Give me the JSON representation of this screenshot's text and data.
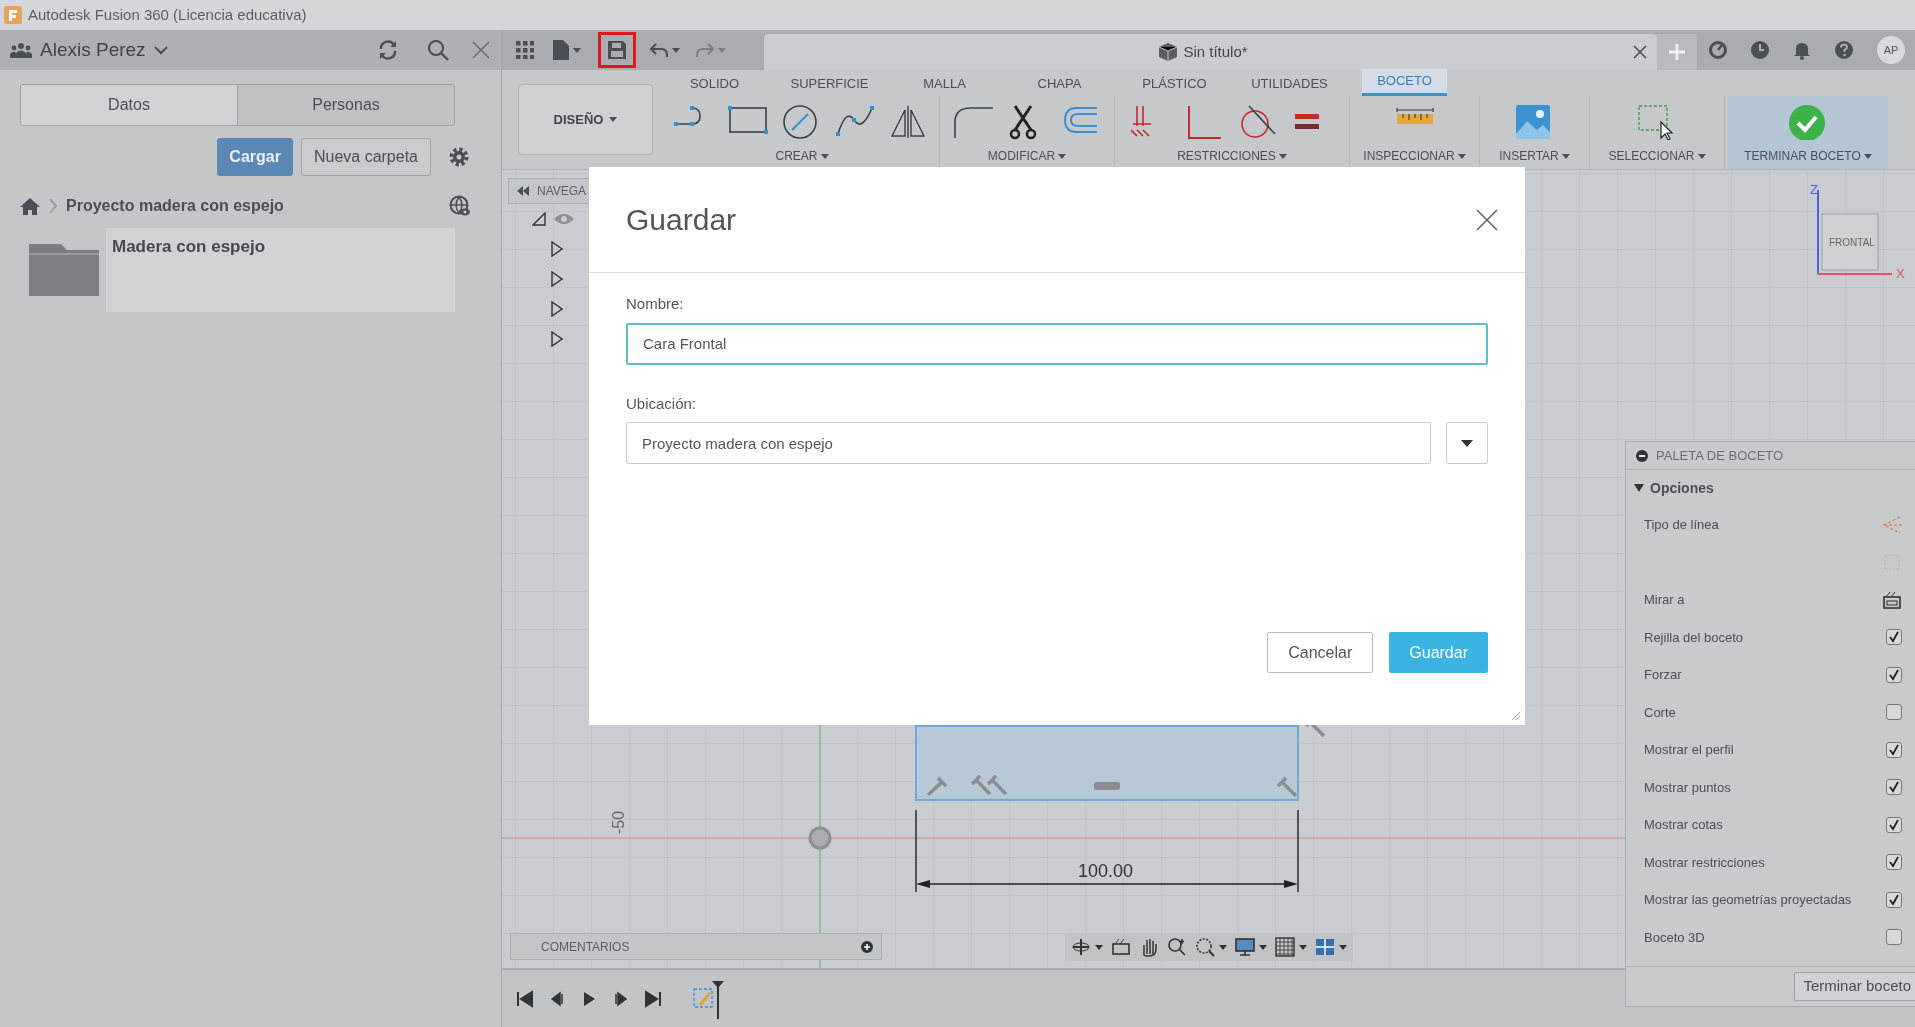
{
  "window": {
    "title": "Autodesk Fusion 360 (Licencia educativa)"
  },
  "data_panel": {
    "user": "Alexis Perez",
    "tabs": [
      {
        "label": "Datos",
        "selected": true
      },
      {
        "label": "Personas",
        "selected": false
      }
    ],
    "buttons": [
      {
        "label": "Cargar",
        "kind": "primary"
      },
      {
        "label": "Nueva carpeta",
        "kind": "secondary"
      }
    ],
    "breadcrumb": "Proyecto madera con espejo",
    "folders": [
      {
        "name": "Madera con espejo"
      }
    ]
  },
  "top_bar": {
    "save_highlighted": true,
    "document_title": "Sin título*",
    "user_initials": "AP"
  },
  "ribbon": {
    "workspace": "DISEÑO",
    "tabs": [
      {
        "label": "SOLIDO",
        "selected": false
      },
      {
        "label": "SUPERFICIE",
        "selected": false
      },
      {
        "label": "MALLA",
        "selected": false
      },
      {
        "label": "CHAPA",
        "selected": false
      },
      {
        "label": "PLÁSTICO",
        "selected": false
      },
      {
        "label": "UTILIDADES",
        "selected": false
      },
      {
        "label": "BOCETO",
        "selected": true
      }
    ],
    "groups": [
      {
        "label": "CREAR"
      },
      {
        "label": "MODIFICAR"
      },
      {
        "label": "RESTRICCIONES"
      },
      {
        "label": "INSPECCIONAR"
      },
      {
        "label": "INSERTAR"
      },
      {
        "label": "SELECCIONAR"
      },
      {
        "label": "TERMINAR BOCETO"
      }
    ]
  },
  "browser": {
    "title": "NAVEGA",
    "nodes": [
      {
        "expanded": true
      },
      {
        "expanded": false
      },
      {
        "expanded": false
      },
      {
        "expanded": false
      },
      {
        "expanded": false
      }
    ]
  },
  "view_cube": {
    "face": "FRONTAL",
    "axes": [
      "Z",
      "X"
    ]
  },
  "sketch": {
    "dimension": "100.00",
    "grid_label": "-50"
  },
  "comments": {
    "title": "COMENTARIOS"
  },
  "dialog": {
    "title": "Guardar",
    "fields": [
      {
        "label": "Nombre:",
        "value": "Cara Frontal",
        "focused": true,
        "kind": "text"
      },
      {
        "label": "Ubicación:",
        "value": "Proyecto madera con espejo",
        "focused": false,
        "kind": "select"
      }
    ],
    "buttons": [
      {
        "label": "Cancelar",
        "kind": "secondary"
      },
      {
        "label": "Guardar",
        "kind": "primary"
      }
    ]
  },
  "sketch_palette": {
    "title": "PALETA DE BOCETO",
    "section": {
      "label": "Opciones",
      "expanded": true
    },
    "rows": [
      {
        "label": "Tipo de línea",
        "kind": "icon",
        "disabled": false
      },
      {
        "kind": "icon",
        "disabled": true
      },
      {
        "label": "Mirar a",
        "kind": "icon",
        "disabled": false
      },
      {
        "label": "Rejilla del boceto",
        "kind": "checkbox",
        "checked": true
      },
      {
        "label": "Forzar",
        "kind": "checkbox",
        "checked": true
      },
      {
        "label": "Corte",
        "kind": "checkbox",
        "checked": false
      },
      {
        "label": "Mostrar el perfil",
        "kind": "checkbox",
        "checked": true
      },
      {
        "label": "Mostrar puntos",
        "kind": "checkbox",
        "checked": true
      },
      {
        "label": "Mostrar cotas",
        "kind": "checkbox",
        "checked": true
      },
      {
        "label": "Mostrar restricciones",
        "kind": "checkbox",
        "checked": true
      },
      {
        "label": "Mostrar las geometrías proyectadas",
        "kind": "checkbox",
        "checked": true
      },
      {
        "label": "Boceto 3D",
        "kind": "checkbox",
        "checked": false
      }
    ],
    "finish_button": "Terminar boceto"
  }
}
